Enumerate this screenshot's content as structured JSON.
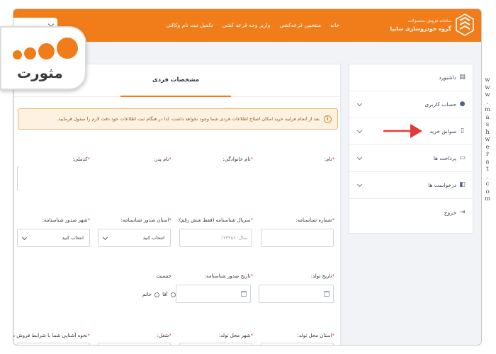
{
  "header": {
    "org_sub": "سامانه فروش محصولات",
    "org_name": "گروه خودروسازی سایپا",
    "nav": [
      "خانه",
      "منتخبین قرعه‌کشی",
      "واریز وجه قرعه کشی",
      "تکمیل ثبت نام وکالتی"
    ]
  },
  "sidebar": {
    "items": [
      {
        "label": "داشبورد",
        "icon": "dashboard-icon",
        "chevron": false
      },
      {
        "label": "حساب کاربری",
        "icon": "user-icon",
        "chevron": true
      },
      {
        "label": "سوابق خرید",
        "icon": "document-icon",
        "chevron": true
      },
      {
        "label": "پرداخت ها",
        "icon": "payment-icon",
        "chevron": true
      },
      {
        "label": "درخواست ها",
        "icon": "requests-icon",
        "chevron": true
      },
      {
        "label": "خروج",
        "icon": "logout-icon",
        "chevron": false
      }
    ]
  },
  "panel": {
    "tab": "مشخصات فردی",
    "alert": "بعد از انجام فرایند خرید امکان اصلاح اطلاعات فردی شما وجود نخواهد داشت، لذا در هنگام ثبت اطلاعات خود دقت لازم را مبذول فرمایید.",
    "labels": {
      "first_name": "نام:",
      "last_name": "نام خانوادگی:",
      "father_name": "نام پدر:",
      "national_code": "کدملی:",
      "id_number": "شماره شناسنامه:",
      "id_serial": "سریال شناسنامه (فقط شش رقم):",
      "issue_province": "استان صدور شناسنامه:",
      "issue_city": "شهر صدور شناسنامه:",
      "birth_date": "تاریخ تولد:",
      "issue_date": "تاریخ صدور شناسنامه:",
      "gender": "جنسیت",
      "birth_province": "استان محل تولد:",
      "birth_city": "شهر محل تولد:",
      "job": "شغل:",
      "acquaintance": "نحوه آشنایی شما با شرایط فروش سایپا:"
    },
    "serial_placeholder": "مثال: ۱۲۳۴۵۶",
    "select_default": "انتخاب کنید",
    "gender_male": "آقا",
    "gender_female": "خانم"
  },
  "badge": {
    "text": "مثورت"
  },
  "watermark": "www.mashwerat.com",
  "colors": {
    "accent": "#f07d1a",
    "alert_bg": "#fdf1e1",
    "required": "#e23b3b",
    "arrow": "#e53935"
  }
}
